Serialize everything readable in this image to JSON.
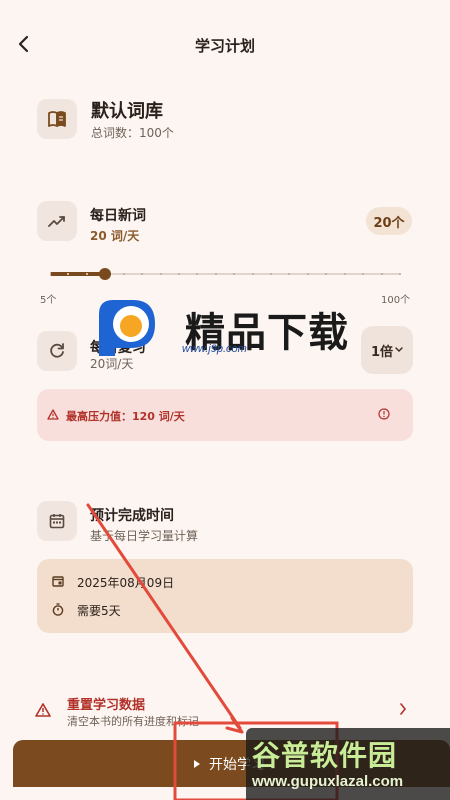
{
  "header": {
    "title": "学习计划"
  },
  "book": {
    "title": "默认词库",
    "count": "总词数：100个"
  },
  "daily_new": {
    "title": "每日新词",
    "value": "20 词/天",
    "chip": "20个",
    "slider": {
      "min_label": "5个",
      "max_label": "100个",
      "min": 5,
      "max": 100,
      "value": 20,
      "step": 5
    }
  },
  "review": {
    "title": "每日复习",
    "value": "20词/天",
    "multiplier": "1倍"
  },
  "warning": {
    "text": "最高压力值：120 词/天"
  },
  "completion": {
    "title": "预计完成时间",
    "subtitle": "基于每日学习量计算",
    "date": "2025年08月09日",
    "needed": "需要5天"
  },
  "reset": {
    "title": "重置学习数据",
    "subtitle": "清空本书的所有进度和标记"
  },
  "start": {
    "label": "开始学习"
  },
  "watermarks": {
    "top_title": "精品下载",
    "top_url": "www.j9p.com",
    "bottom_title": "谷普软件园",
    "bottom_url": "www.gupuxlazal.com"
  },
  "colors": {
    "background": "#fdf5f1",
    "primary": "#7b4a1e",
    "danger": "#b2322a",
    "tile": "#f0e5df"
  }
}
